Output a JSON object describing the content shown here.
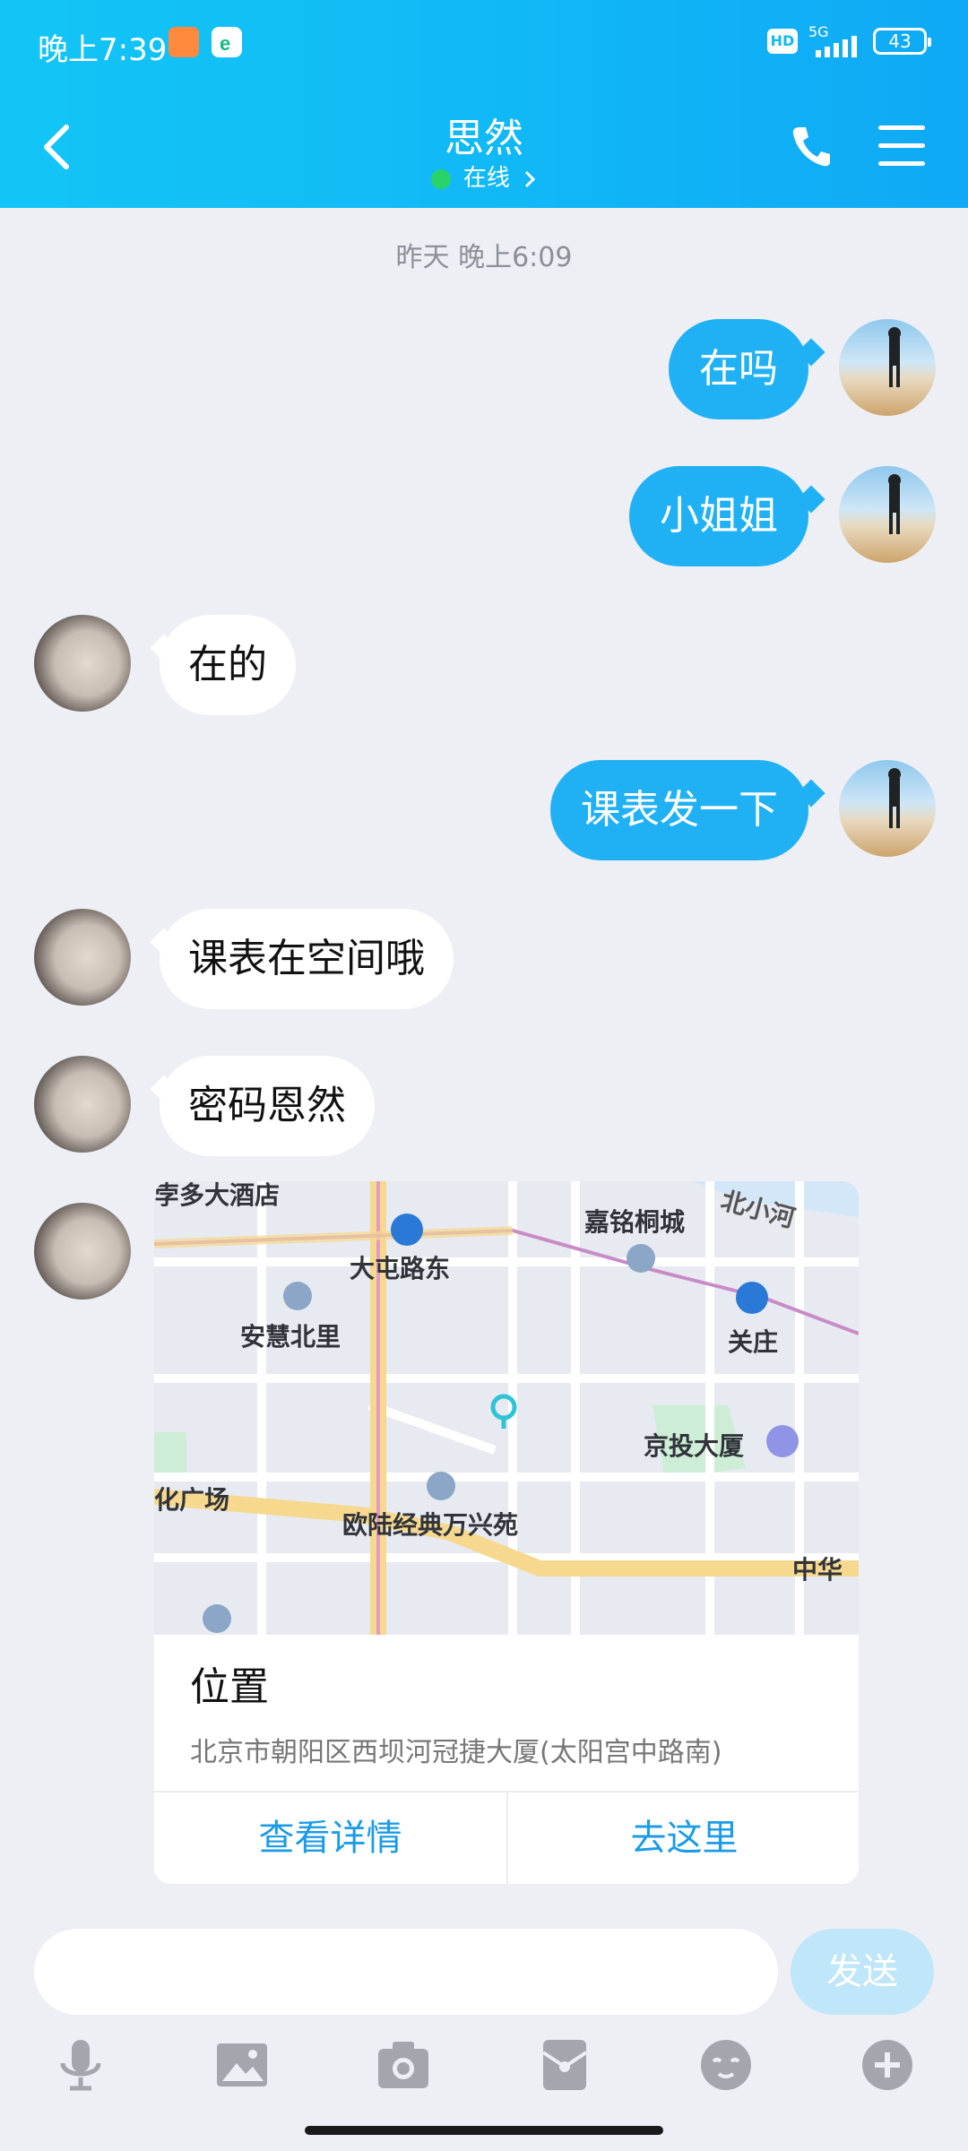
{
  "status_bar": {
    "time": "晚上7:39",
    "hd": "HD",
    "network": "5G",
    "battery": "43"
  },
  "header": {
    "title": "思然",
    "status": "在线"
  },
  "chat": {
    "timestamp": "昨天 晚上6:09",
    "messages": [
      {
        "side": "out",
        "text": "在吗"
      },
      {
        "side": "out",
        "text": "小姐姐"
      },
      {
        "side": "in",
        "text": "在的"
      },
      {
        "side": "out",
        "text": "课表发一下"
      },
      {
        "side": "in",
        "text": "课表在空间哦"
      },
      {
        "side": "in",
        "text": "密码恩然"
      }
    ],
    "location_card": {
      "title": "位置",
      "address": "北京市朝阳区西坝河冠捷大厦(太阳宫中路南)",
      "view_details": "查看详情",
      "go_here": "去这里",
      "map_labels": [
        "大屯路东",
        "嘉铭桐城",
        "安慧北里",
        "关庄",
        "京投大厦",
        "化广场",
        "欧陆经典万兴苑",
        "中华",
        "北小河",
        "孛多大酒店"
      ]
    }
  },
  "input": {
    "send_label": "发送"
  },
  "colors": {
    "header": "#13C5F6",
    "bubble_out": "#20B1F5",
    "link": "#1C9BE6"
  },
  "toolbar": {
    "icons": [
      "mic-icon",
      "image-icon",
      "camera-icon",
      "red-packet-icon",
      "emoji-icon",
      "plus-icon"
    ]
  }
}
